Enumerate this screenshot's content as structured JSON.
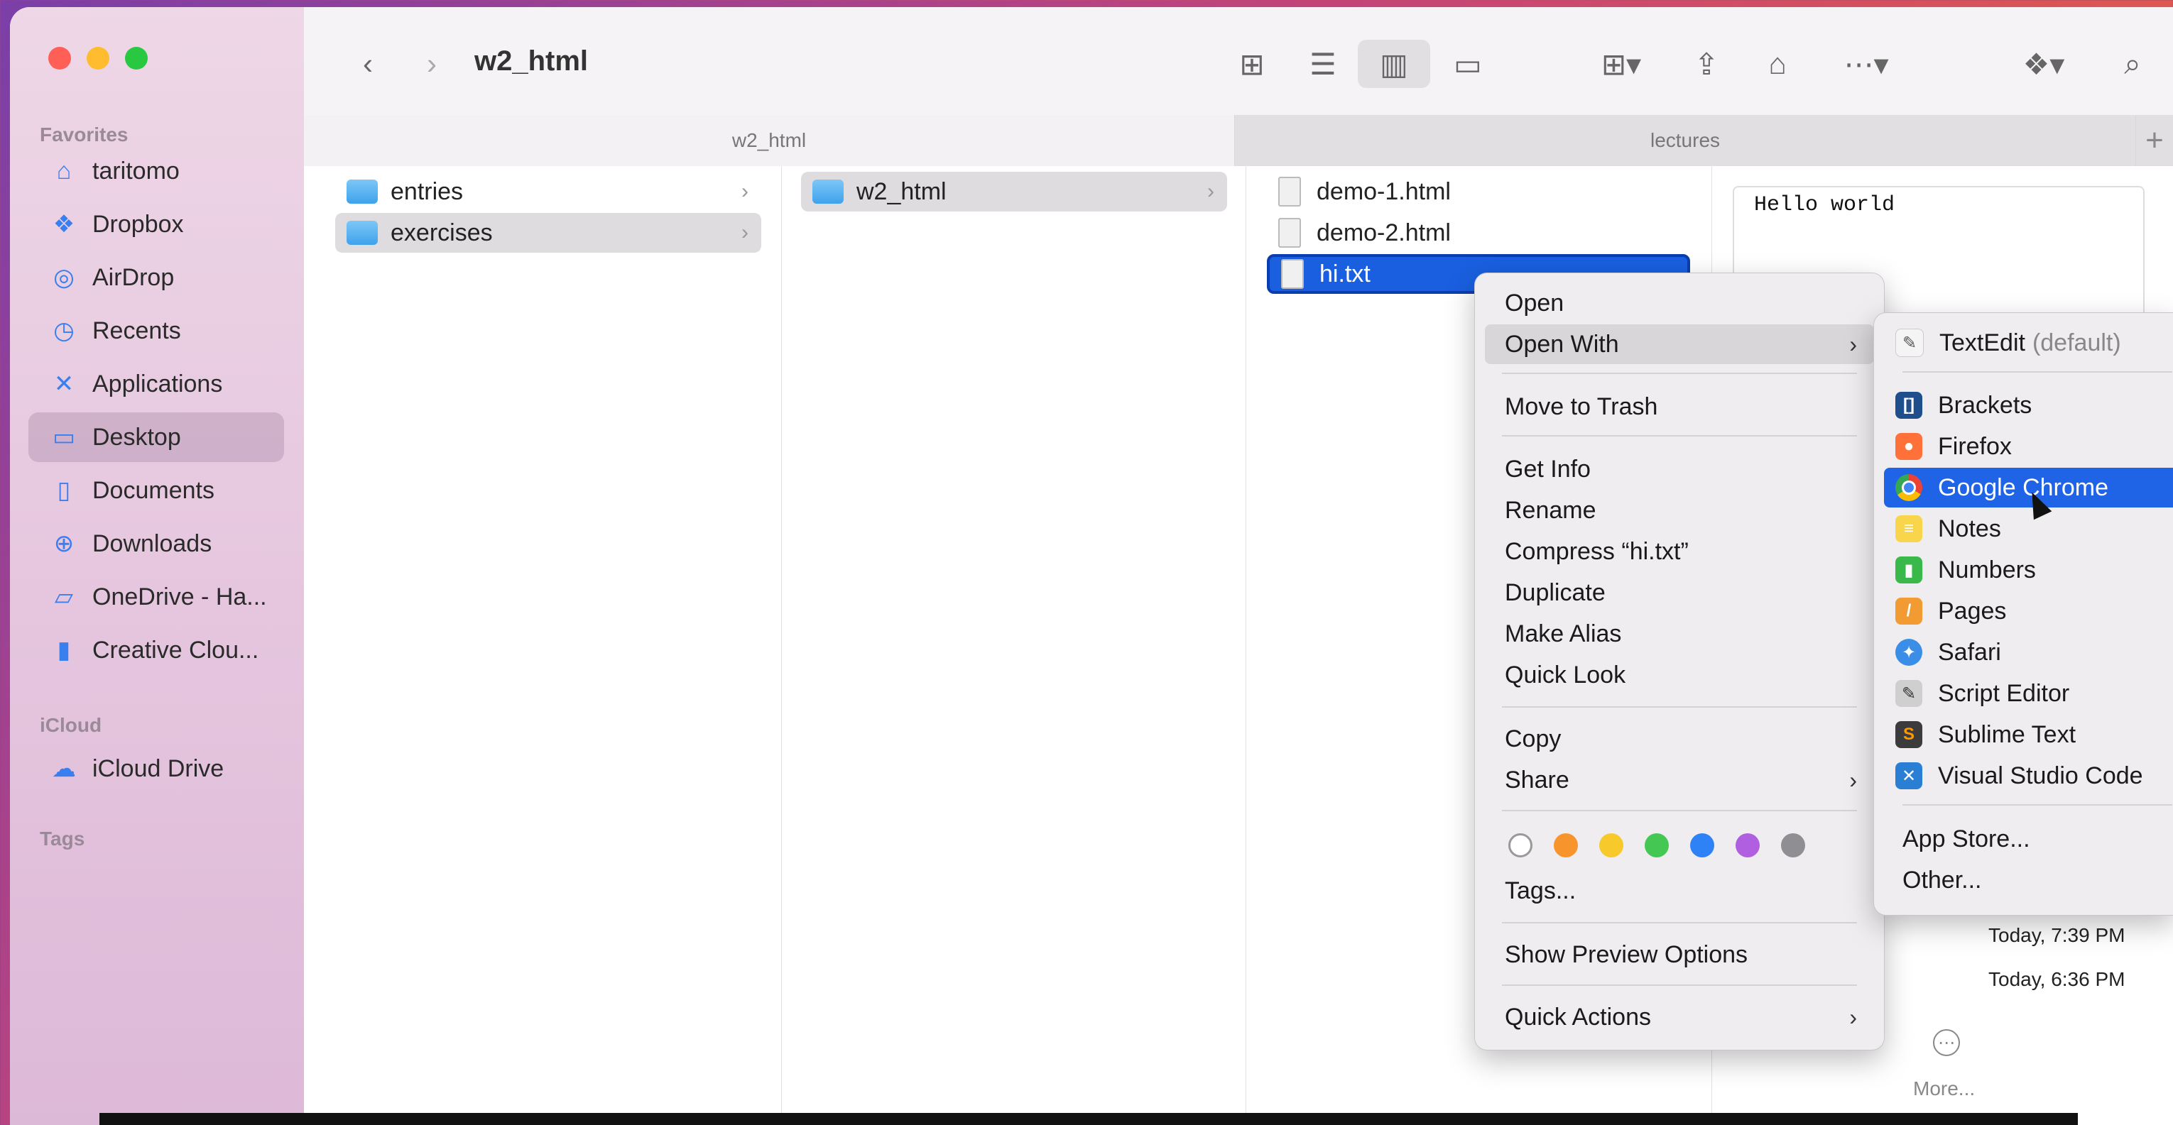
{
  "window": {
    "title": "w2_html"
  },
  "sidebar": {
    "favorites_label": "Favorites",
    "favorites": [
      {
        "label": "taritomo",
        "icon": "house-icon"
      },
      {
        "label": "Dropbox",
        "icon": "dropbox-icon"
      },
      {
        "label": "AirDrop",
        "icon": "airdrop-icon"
      },
      {
        "label": "Recents",
        "icon": "clock-icon"
      },
      {
        "label": "Applications",
        "icon": "applications-icon"
      },
      {
        "label": "Desktop",
        "icon": "desktop-icon",
        "selected": true
      },
      {
        "label": "Documents",
        "icon": "document-icon"
      },
      {
        "label": "Downloads",
        "icon": "download-icon"
      },
      {
        "label": "OneDrive - Ha...",
        "icon": "folder-icon"
      },
      {
        "label": "Creative Clou...",
        "icon": "file-icon"
      }
    ],
    "icloud_label": "iCloud",
    "icloud": [
      {
        "label": "iCloud Drive",
        "icon": "cloud-icon"
      }
    ],
    "tags_label": "Tags"
  },
  "tabs": [
    {
      "label": "w2_html",
      "active": true
    },
    {
      "label": "lectures",
      "active": false
    }
  ],
  "columns": {
    "col1": [
      {
        "name": "entries"
      },
      {
        "name": "exercises",
        "selected": true
      }
    ],
    "col2": [
      {
        "name": "w2_html",
        "selected": true
      }
    ],
    "col3": [
      {
        "name": "demo-1.html"
      },
      {
        "name": "demo-2.html"
      },
      {
        "name": "hi.txt",
        "selected": true
      }
    ]
  },
  "preview": {
    "content": "Hello world",
    "date1": "Today, 7:39 PM",
    "date2": "Today, 6:36 PM",
    "more_label": "More..."
  },
  "context_menu": {
    "open": "Open",
    "open_with": "Open With",
    "move_to_trash": "Move to Trash",
    "get_info": "Get Info",
    "rename": "Rename",
    "compress": "Compress “hi.txt”",
    "duplicate": "Duplicate",
    "make_alias": "Make Alias",
    "quick_look": "Quick Look",
    "copy": "Copy",
    "share": "Share",
    "tags": "Tags...",
    "show_preview_options": "Show Preview Options",
    "quick_actions": "Quick Actions",
    "tag_colors": [
      "#ffffff",
      "#f7952c",
      "#f8c92b",
      "#45c754",
      "#2f82f5",
      "#b05fe0",
      "#8e8e93"
    ]
  },
  "open_with_menu": {
    "default_app": "TextEdit",
    "default_suffix": "(default)",
    "apps": [
      {
        "label": "Brackets",
        "color": "#1e4f8c",
        "glyph": "[]"
      },
      {
        "label": "Firefox",
        "color": "#ff7139",
        "glyph": "●"
      },
      {
        "label": "Google Chrome",
        "color": "#ffffff",
        "glyph": "◉",
        "highlighted": true
      },
      {
        "label": "Notes",
        "color": "#f8d54a",
        "glyph": "≡"
      },
      {
        "label": "Numbers",
        "color": "#39b94a",
        "glyph": "▮"
      },
      {
        "label": "Pages",
        "color": "#f29b33",
        "glyph": "/"
      },
      {
        "label": "Safari",
        "color": "#3a8ee8",
        "glyph": "✦"
      },
      {
        "label": "Script Editor",
        "color": "#cfcfcf",
        "glyph": "✎"
      },
      {
        "label": "Sublime Text",
        "color": "#3b3b3b",
        "glyph": "S"
      },
      {
        "label": "Visual Studio Code",
        "color": "#2a7fd4",
        "glyph": "✕"
      }
    ],
    "app_store": "App Store...",
    "other": "Other..."
  }
}
